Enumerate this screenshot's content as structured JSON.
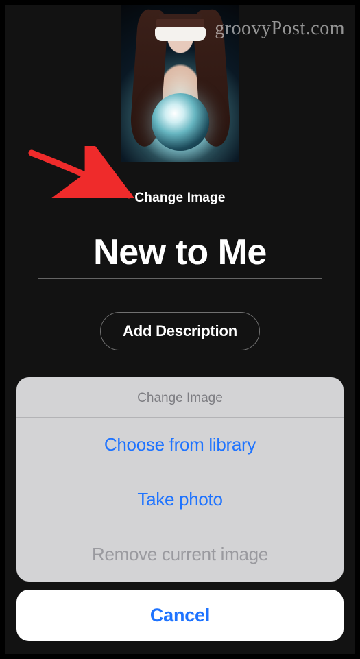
{
  "watermark": "groovyPost.com",
  "editor": {
    "change_image_label": "Change Image",
    "playlist_title": "New to Me",
    "add_description_label": "Add Description"
  },
  "action_sheet": {
    "title": "Change Image",
    "options": {
      "choose_library": "Choose from library",
      "take_photo": "Take photo",
      "remove_current": "Remove current image"
    },
    "cancel": "Cancel"
  }
}
